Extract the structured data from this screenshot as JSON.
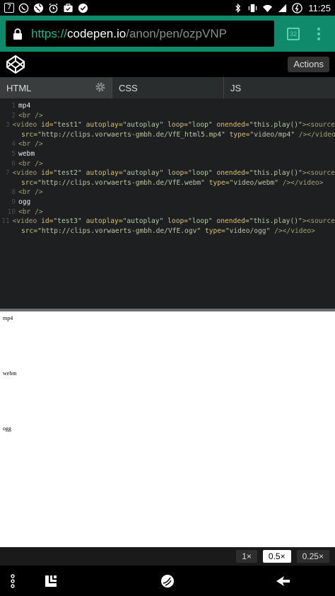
{
  "status_bar": {
    "notification_badge": "7",
    "time": "11:25"
  },
  "browser": {
    "url_scheme": "https://",
    "url_host": "codepen.io",
    "url_path": "/anon/pen/ozpVNP",
    "tab_count": "32"
  },
  "codepen": {
    "actions_label": "Actions",
    "tabs": [
      {
        "label": "HTML"
      },
      {
        "label": "CSS"
      },
      {
        "label": "JS"
      }
    ]
  },
  "code": {
    "line_numbers": [
      "1",
      "2",
      "3",
      "4",
      "5",
      "6",
      "7",
      "8",
      "9",
      "10",
      "11"
    ],
    "text_mp4": "mp4",
    "text_webm": "webm",
    "text_ogg": "ogg",
    "br": "<br />",
    "video_open": "<video",
    "id_attr": "id=",
    "autoplay_attr": "autoplay=",
    "loop_attr": "loop=",
    "onended_attr": "onended=",
    "source_open": "><source",
    "src_attr": "src=",
    "type_attr": "type=",
    "close_tags": " /></video>",
    "id1": "\"test1\"",
    "id2": "\"test2\"",
    "id3": "\"test3\"",
    "autoplay_val": "\"autoplay\"",
    "loop_val": "\"loop\"",
    "onended_val": "\"this.play()\"",
    "src1": "\"http://clips.vorwaerts-gmbh.de/VfE_html5.mp4\"",
    "src2": "\"http://clips.vorwaerts-gmbh.de/VfE.webm\"",
    "src3": "\"http://clips.vorwaerts-gmbh.de/VfE.ogv\"",
    "type1": "\"video/mp4\"",
    "type2": "\"video/webm\"",
    "type3": "\"video/ogg\""
  },
  "preview": {
    "labels": [
      "mp4",
      "webm",
      "ogg"
    ]
  },
  "zoom": {
    "options": [
      "1×",
      "0.5×",
      "0.25×"
    ],
    "selected": "0.5×"
  }
}
